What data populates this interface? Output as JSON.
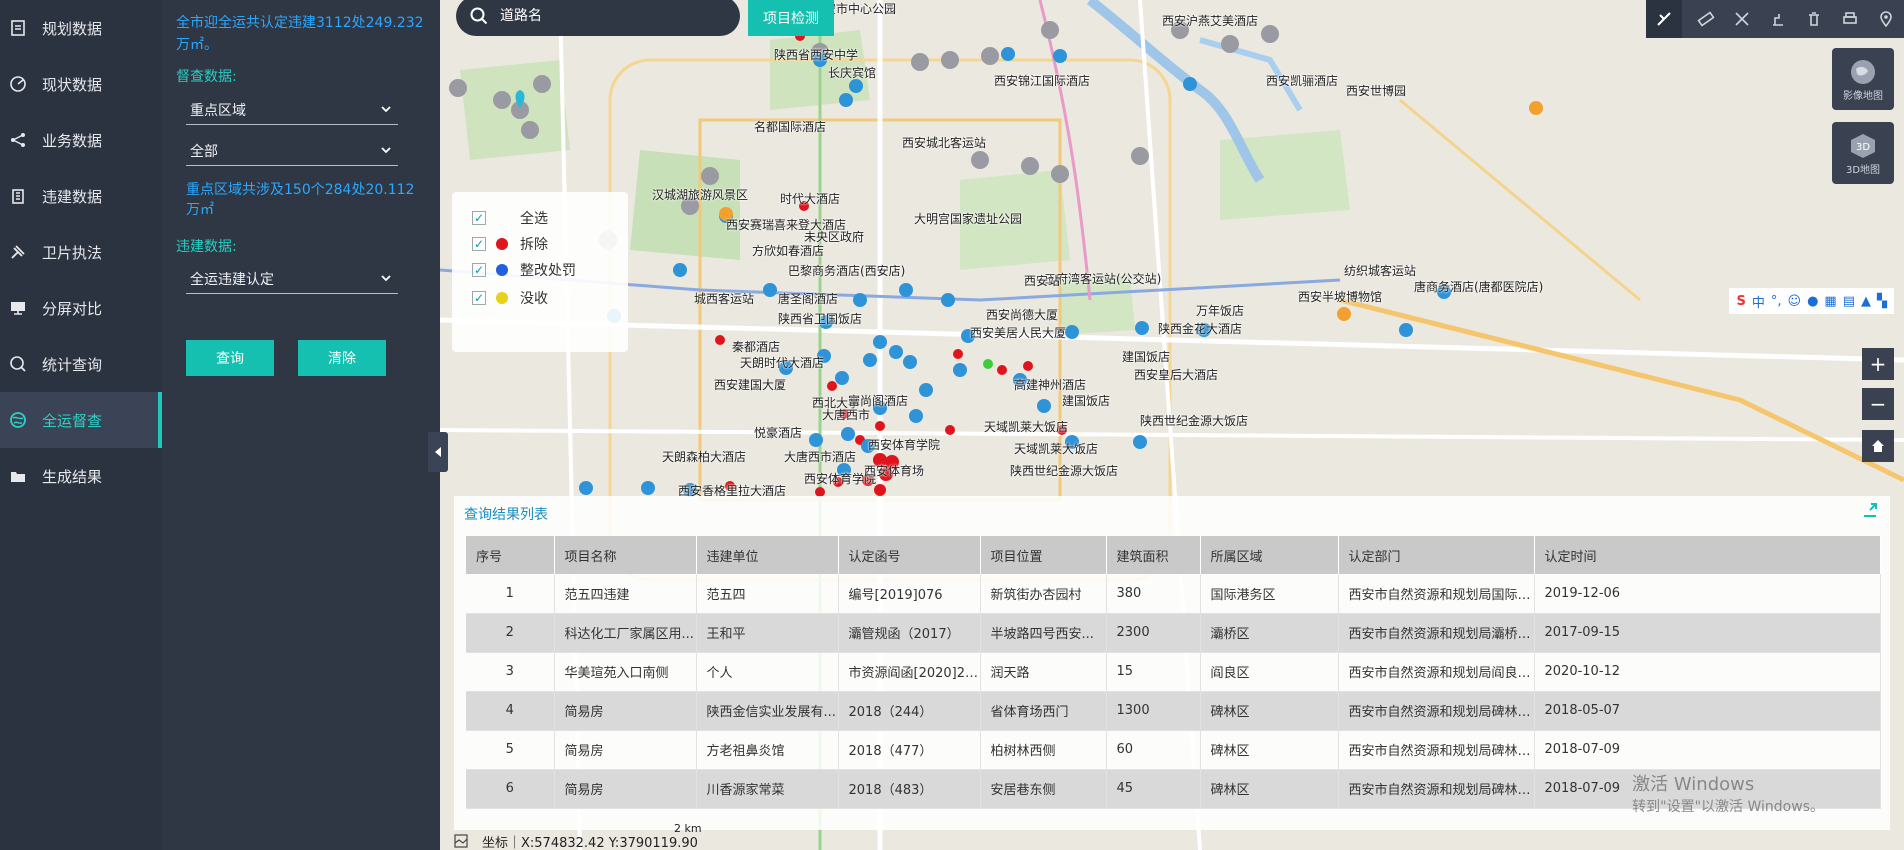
{
  "nav": {
    "items": [
      {
        "label": "规划数据",
        "icon": "document-icon"
      },
      {
        "label": "现状数据",
        "icon": "radar-icon"
      },
      {
        "label": "业务数据",
        "icon": "share-icon"
      },
      {
        "label": "违建数据",
        "icon": "building-icon"
      },
      {
        "label": "卫片执法",
        "icon": "satellite-icon"
      },
      {
        "label": "分屏对比",
        "icon": "monitor-icon"
      },
      {
        "label": "统计查询",
        "icon": "search-chart-icon"
      },
      {
        "label": "全运督查",
        "icon": "globe-icon"
      },
      {
        "label": "生成结果",
        "icon": "folder-icon"
      }
    ],
    "active_index": 7
  },
  "panel": {
    "summary": "全市迎全运共认定违建3112处249.232万㎡。",
    "supervision_title": "督查数据:",
    "region_select": "重点区域",
    "scope_select": "全部",
    "region_note": "重点区域共涉及150个284处20.112万㎡",
    "violation_title": "违建数据:",
    "violation_select": "全运违建认定",
    "query_button": "查询",
    "clear_button": "清除"
  },
  "map": {
    "search_placeholder": "道路名",
    "detect_button": "项目检测",
    "layers": {
      "image": "影像地图",
      "three_d": "3D地图"
    },
    "legend": [
      {
        "label": "全选",
        "color": ""
      },
      {
        "label": "拆除",
        "color": "#e0141c"
      },
      {
        "label": "整改处罚",
        "color": "#1f5fe0"
      },
      {
        "label": "没收",
        "color": "#e6d21a"
      }
    ],
    "ime_label": "中",
    "labels": [
      "西安市中心公园",
      "西安沪燕艾美酒店",
      "陕西省西安中学",
      "长庆宾馆",
      "西安锦江国际酒店",
      "西安凯骊酒店",
      "西安世博园",
      "名都国际酒店",
      "西安城北客运站",
      "时代大酒店",
      "大明宫国家遗址公园",
      "汉城湖旅游风景区",
      "西安赛瑞喜来登大酒店",
      "未央区政府",
      "方欣如春酒店",
      "巴黎商务酒店(西安店)",
      "三府湾客运站(公交站)",
      "纺织城客运站",
      "西安半坡博物馆",
      "唐商务酒店(唐都医院店)",
      "城西客运站",
      "唐圣阁酒店",
      "西安站",
      "陕西省卫国饭店",
      "西安尚德大厦",
      "万年饭店",
      "西安美居人民大厦",
      "陕西金花大酒店",
      "秦都酒店",
      "天朗时代大酒店",
      "建国饭店",
      "西安皇后大酒店",
      "西安建国大厦",
      "西北大学",
      "富尚阁酒店",
      "高建神州酒店",
      "建国饭店",
      "大唐西市",
      "陕西世纪金源大饭店",
      "天域凯莱大饭店",
      "悦豪酒店",
      "西安体育学院",
      "天朗森柏大酒店",
      "大唐西市酒店",
      "天域凯莱大饭店",
      "陕西世纪金源大饭店",
      "西安体育学院",
      "西安香格里拉大酒店",
      "西安体育场"
    ],
    "coord_text": "坐标｜X:574832.42 Y:3790119.90",
    "scale_text": "2 km",
    "watermark_line1": "激活 Windows",
    "watermark_line2": "转到\"设置\"以激活 Windows。"
  },
  "results": {
    "title": "查询结果列表",
    "columns": [
      "序号",
      "项目名称",
      "违建单位",
      "认定函号",
      "项目位置",
      "建筑面积",
      "所属区域",
      "认定部门",
      "认定时间"
    ],
    "rows": [
      [
        "1",
        "范五四违建",
        "范五四",
        "编号[2019]076",
        "新筑街办杏园村",
        "380",
        "国际港务区",
        "西安市自然资源和规划局国际港...",
        "2019-12-06"
      ],
      [
        "2",
        "科达化工厂家属区用...",
        "王和平",
        "灞管规函（2017）",
        "半坡路四号西安...",
        "2300",
        "灞桥区",
        "西安市自然资源和规划局灞桥分...",
        "2017-09-15"
      ],
      [
        "3",
        "华美瑄苑入口南侧",
        "个人",
        "市资源阎函[2020]23...",
        "润天路",
        "15",
        "阎良区",
        "西安市自然资源和规划局阎良分...",
        "2020-10-12"
      ],
      [
        "4",
        "简易房",
        "陕西金信实业发展有...",
        "2018（244）",
        "省体育场西门",
        "1300",
        "碑林区",
        "西安市自然资源和规划局碑林分...",
        "2018-05-07"
      ],
      [
        "5",
        "简易房",
        "方老祖鼻炎馆",
        "2018（477）",
        "柏树林西侧",
        "60",
        "碑林区",
        "西安市自然资源和规划局碑林分...",
        "2018-07-09"
      ],
      [
        "6",
        "简易房",
        "川香源家常菜",
        "2018（483）",
        "安居巷东侧",
        "45",
        "碑林区",
        "西安市自然资源和规划局碑林分...",
        "2018-07-09"
      ]
    ]
  }
}
